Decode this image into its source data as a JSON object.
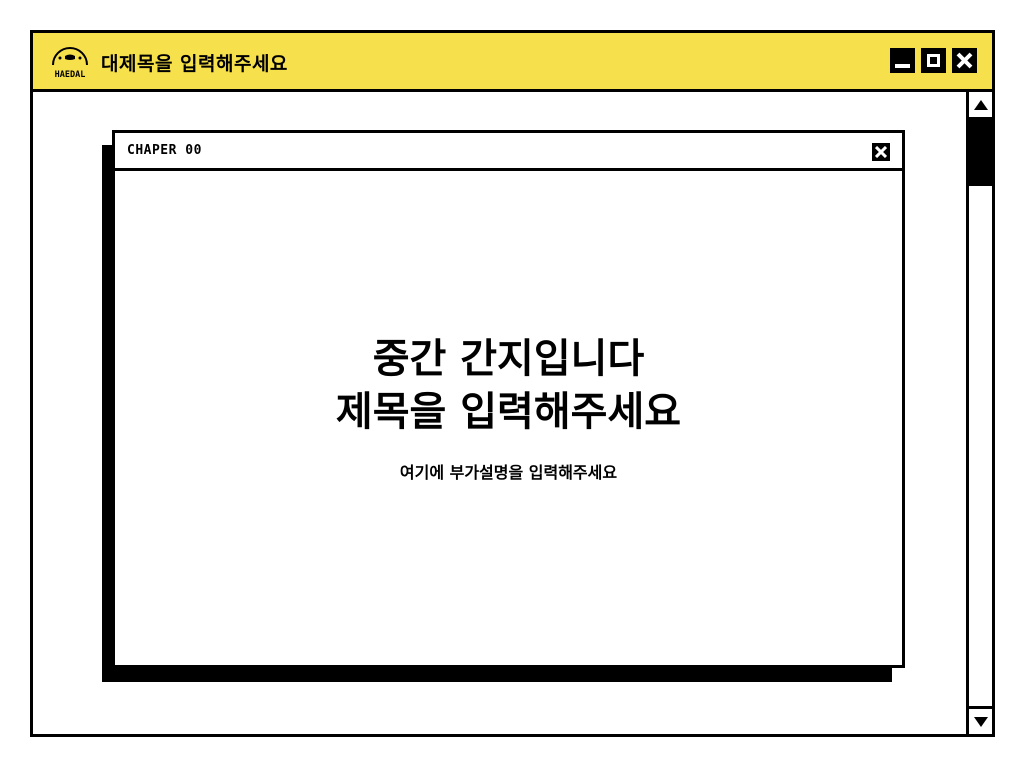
{
  "app": {
    "logo_text": "HAEDAL",
    "title": "대제목을 입력해주세요"
  },
  "window_controls": {
    "minimize": "minimize-icon",
    "maximize": "maximize-icon",
    "close": "close-icon"
  },
  "dialog": {
    "chapter_label": "CHAPER 00",
    "headline_line1": "중간 간지입니다",
    "headline_line2": "제목을 입력해주세요",
    "subtitle": "여기에 부가설명을 입력해주세요"
  },
  "colors": {
    "titlebar": "#f6e04b",
    "border": "#000000",
    "background": "#ffffff"
  }
}
